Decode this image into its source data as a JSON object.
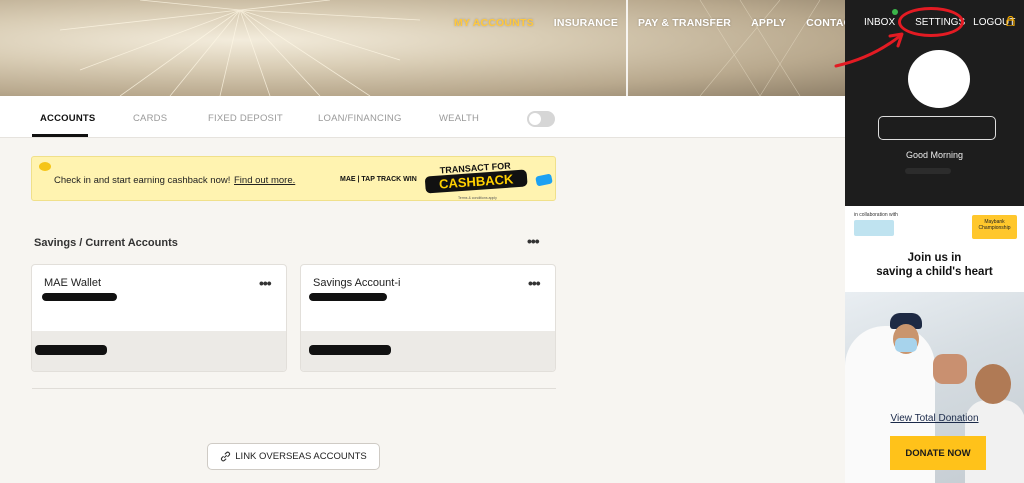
{
  "top_nav": {
    "items": [
      "MY ACCOUNTS",
      "INSURANCE",
      "PAY & TRANSFER",
      "APPLY",
      "CONTACT US"
    ],
    "active": "MY ACCOUNTS"
  },
  "user_panel": {
    "inbox": "INBOX",
    "settings": "SETTINGS",
    "logout": "LOGOUT",
    "greeting": "Good Morning"
  },
  "account_tabs": {
    "items": [
      "ACCOUNTS",
      "CARDS",
      "FIXED DEPOSIT",
      "LOAN/FINANCING",
      "WEALTH"
    ],
    "active": "ACCOUNTS"
  },
  "promo": {
    "text": "Check in and start earning cashback now!",
    "link": "Find out more.",
    "badge": "MAE | TAP TRACK WIN",
    "headline_top": "TRANSACT FOR",
    "headline_bottom": "CASHBACK",
    "terms": "Terms & conditions apply"
  },
  "savings": {
    "title": "Savings / Current Accounts",
    "accounts": [
      {
        "name": "MAE Wallet"
      },
      {
        "name": "Savings Account-i"
      }
    ]
  },
  "link_overseas": "LINK OVERSEAS ACCOUNTS",
  "ad": {
    "collab": "in collaboration with",
    "sponsor": "Maybank Championship",
    "headline_1": "Join us in",
    "headline_2": "saving a child's heart",
    "link": "View Total Donation",
    "button": "DONATE NOW"
  },
  "colors": {
    "accent": "#ffc83d",
    "panel_dark": "#1d1d1d",
    "annotation": "#e31b23",
    "donate": "#ffc21a"
  }
}
